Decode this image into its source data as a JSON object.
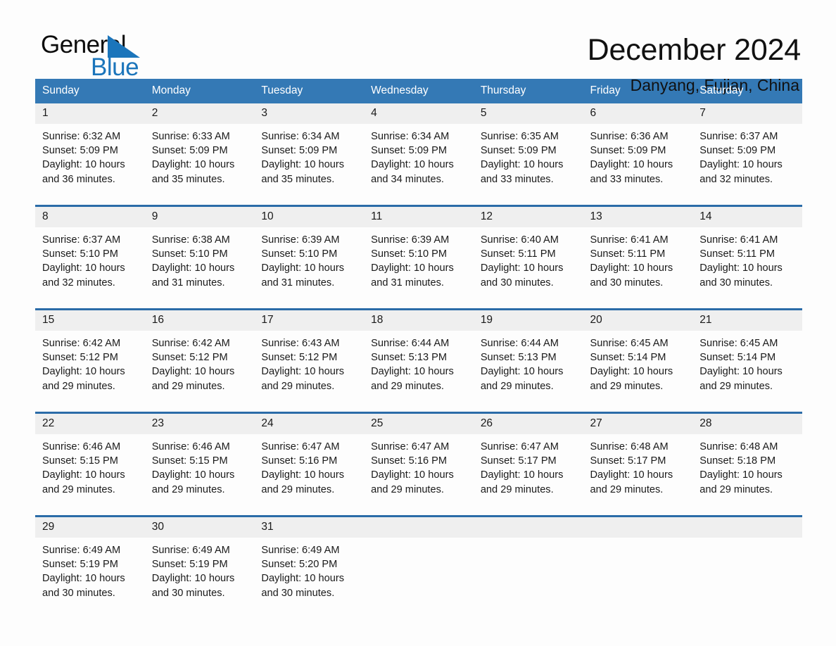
{
  "brand": {
    "name_top": "General",
    "name_bottom": "Blue",
    "accent_color": "#1b75bb"
  },
  "header": {
    "month_title": "December 2024",
    "location": "Danyang, Fujian, China"
  },
  "theme": {
    "header_row_bg": "#3479b5",
    "row_rule_color": "#2b6ca8",
    "daynum_band_bg": "#efefef",
    "page_bg": "#fdfdfd",
    "text_color": "#1a1a1a"
  },
  "calendar": {
    "weekday_headers": [
      "Sunday",
      "Monday",
      "Tuesday",
      "Wednesday",
      "Thursday",
      "Friday",
      "Saturday"
    ],
    "weeks": [
      [
        {
          "day": "1",
          "sunrise": "Sunrise: 6:32 AM",
          "sunset": "Sunset: 5:09 PM",
          "daylight_1": "Daylight: 10 hours",
          "daylight_2": "and 36 minutes."
        },
        {
          "day": "2",
          "sunrise": "Sunrise: 6:33 AM",
          "sunset": "Sunset: 5:09 PM",
          "daylight_1": "Daylight: 10 hours",
          "daylight_2": "and 35 minutes."
        },
        {
          "day": "3",
          "sunrise": "Sunrise: 6:34 AM",
          "sunset": "Sunset: 5:09 PM",
          "daylight_1": "Daylight: 10 hours",
          "daylight_2": "and 35 minutes."
        },
        {
          "day": "4",
          "sunrise": "Sunrise: 6:34 AM",
          "sunset": "Sunset: 5:09 PM",
          "daylight_1": "Daylight: 10 hours",
          "daylight_2": "and 34 minutes."
        },
        {
          "day": "5",
          "sunrise": "Sunrise: 6:35 AM",
          "sunset": "Sunset: 5:09 PM",
          "daylight_1": "Daylight: 10 hours",
          "daylight_2": "and 33 minutes."
        },
        {
          "day": "6",
          "sunrise": "Sunrise: 6:36 AM",
          "sunset": "Sunset: 5:09 PM",
          "daylight_1": "Daylight: 10 hours",
          "daylight_2": "and 33 minutes."
        },
        {
          "day": "7",
          "sunrise": "Sunrise: 6:37 AM",
          "sunset": "Sunset: 5:09 PM",
          "daylight_1": "Daylight: 10 hours",
          "daylight_2": "and 32 minutes."
        }
      ],
      [
        {
          "day": "8",
          "sunrise": "Sunrise: 6:37 AM",
          "sunset": "Sunset: 5:10 PM",
          "daylight_1": "Daylight: 10 hours",
          "daylight_2": "and 32 minutes."
        },
        {
          "day": "9",
          "sunrise": "Sunrise: 6:38 AM",
          "sunset": "Sunset: 5:10 PM",
          "daylight_1": "Daylight: 10 hours",
          "daylight_2": "and 31 minutes."
        },
        {
          "day": "10",
          "sunrise": "Sunrise: 6:39 AM",
          "sunset": "Sunset: 5:10 PM",
          "daylight_1": "Daylight: 10 hours",
          "daylight_2": "and 31 minutes."
        },
        {
          "day": "11",
          "sunrise": "Sunrise: 6:39 AM",
          "sunset": "Sunset: 5:10 PM",
          "daylight_1": "Daylight: 10 hours",
          "daylight_2": "and 31 minutes."
        },
        {
          "day": "12",
          "sunrise": "Sunrise: 6:40 AM",
          "sunset": "Sunset: 5:11 PM",
          "daylight_1": "Daylight: 10 hours",
          "daylight_2": "and 30 minutes."
        },
        {
          "day": "13",
          "sunrise": "Sunrise: 6:41 AM",
          "sunset": "Sunset: 5:11 PM",
          "daylight_1": "Daylight: 10 hours",
          "daylight_2": "and 30 minutes."
        },
        {
          "day": "14",
          "sunrise": "Sunrise: 6:41 AM",
          "sunset": "Sunset: 5:11 PM",
          "daylight_1": "Daylight: 10 hours",
          "daylight_2": "and 30 minutes."
        }
      ],
      [
        {
          "day": "15",
          "sunrise": "Sunrise: 6:42 AM",
          "sunset": "Sunset: 5:12 PM",
          "daylight_1": "Daylight: 10 hours",
          "daylight_2": "and 29 minutes."
        },
        {
          "day": "16",
          "sunrise": "Sunrise: 6:42 AM",
          "sunset": "Sunset: 5:12 PM",
          "daylight_1": "Daylight: 10 hours",
          "daylight_2": "and 29 minutes."
        },
        {
          "day": "17",
          "sunrise": "Sunrise: 6:43 AM",
          "sunset": "Sunset: 5:12 PM",
          "daylight_1": "Daylight: 10 hours",
          "daylight_2": "and 29 minutes."
        },
        {
          "day": "18",
          "sunrise": "Sunrise: 6:44 AM",
          "sunset": "Sunset: 5:13 PM",
          "daylight_1": "Daylight: 10 hours",
          "daylight_2": "and 29 minutes."
        },
        {
          "day": "19",
          "sunrise": "Sunrise: 6:44 AM",
          "sunset": "Sunset: 5:13 PM",
          "daylight_1": "Daylight: 10 hours",
          "daylight_2": "and 29 minutes."
        },
        {
          "day": "20",
          "sunrise": "Sunrise: 6:45 AM",
          "sunset": "Sunset: 5:14 PM",
          "daylight_1": "Daylight: 10 hours",
          "daylight_2": "and 29 minutes."
        },
        {
          "day": "21",
          "sunrise": "Sunrise: 6:45 AM",
          "sunset": "Sunset: 5:14 PM",
          "daylight_1": "Daylight: 10 hours",
          "daylight_2": "and 29 minutes."
        }
      ],
      [
        {
          "day": "22",
          "sunrise": "Sunrise: 6:46 AM",
          "sunset": "Sunset: 5:15 PM",
          "daylight_1": "Daylight: 10 hours",
          "daylight_2": "and 29 minutes."
        },
        {
          "day": "23",
          "sunrise": "Sunrise: 6:46 AM",
          "sunset": "Sunset: 5:15 PM",
          "daylight_1": "Daylight: 10 hours",
          "daylight_2": "and 29 minutes."
        },
        {
          "day": "24",
          "sunrise": "Sunrise: 6:47 AM",
          "sunset": "Sunset: 5:16 PM",
          "daylight_1": "Daylight: 10 hours",
          "daylight_2": "and 29 minutes."
        },
        {
          "day": "25",
          "sunrise": "Sunrise: 6:47 AM",
          "sunset": "Sunset: 5:16 PM",
          "daylight_1": "Daylight: 10 hours",
          "daylight_2": "and 29 minutes."
        },
        {
          "day": "26",
          "sunrise": "Sunrise: 6:47 AM",
          "sunset": "Sunset: 5:17 PM",
          "daylight_1": "Daylight: 10 hours",
          "daylight_2": "and 29 minutes."
        },
        {
          "day": "27",
          "sunrise": "Sunrise: 6:48 AM",
          "sunset": "Sunset: 5:17 PM",
          "daylight_1": "Daylight: 10 hours",
          "daylight_2": "and 29 minutes."
        },
        {
          "day": "28",
          "sunrise": "Sunrise: 6:48 AM",
          "sunset": "Sunset: 5:18 PM",
          "daylight_1": "Daylight: 10 hours",
          "daylight_2": "and 29 minutes."
        }
      ],
      [
        {
          "day": "29",
          "sunrise": "Sunrise: 6:49 AM",
          "sunset": "Sunset: 5:19 PM",
          "daylight_1": "Daylight: 10 hours",
          "daylight_2": "and 30 minutes."
        },
        {
          "day": "30",
          "sunrise": "Sunrise: 6:49 AM",
          "sunset": "Sunset: 5:19 PM",
          "daylight_1": "Daylight: 10 hours",
          "daylight_2": "and 30 minutes."
        },
        {
          "day": "31",
          "sunrise": "Sunrise: 6:49 AM",
          "sunset": "Sunset: 5:20 PM",
          "daylight_1": "Daylight: 10 hours",
          "daylight_2": "and 30 minutes."
        },
        {
          "day": "",
          "sunrise": "",
          "sunset": "",
          "daylight_1": "",
          "daylight_2": ""
        },
        {
          "day": "",
          "sunrise": "",
          "sunset": "",
          "daylight_1": "",
          "daylight_2": ""
        },
        {
          "day": "",
          "sunrise": "",
          "sunset": "",
          "daylight_1": "",
          "daylight_2": ""
        },
        {
          "day": "",
          "sunrise": "",
          "sunset": "",
          "daylight_1": "",
          "daylight_2": ""
        }
      ]
    ]
  }
}
